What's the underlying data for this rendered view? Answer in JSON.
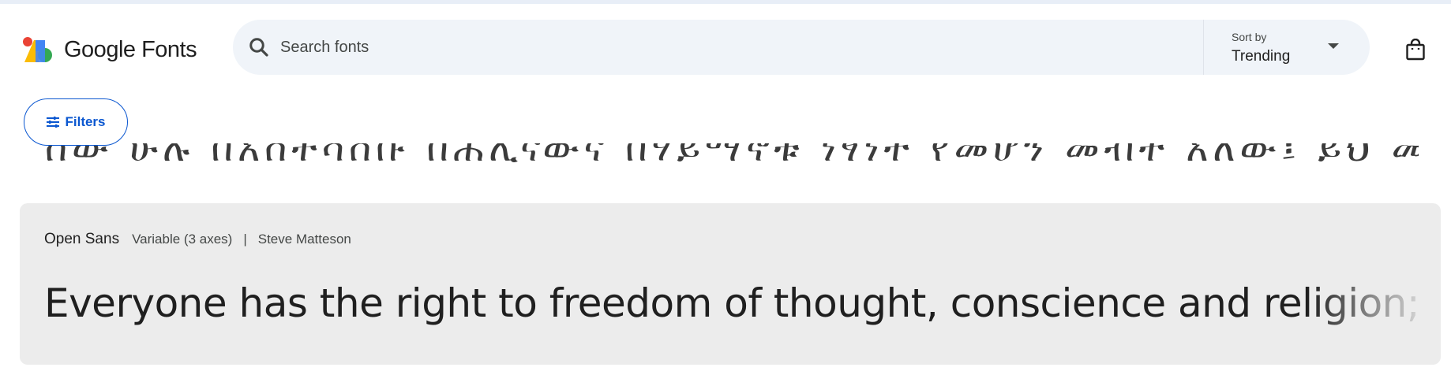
{
  "header": {
    "logo_text": "Google Fonts",
    "search": {
      "placeholder": "Search fonts",
      "value": ""
    },
    "sort": {
      "label": "Sort by",
      "value": "Trending"
    }
  },
  "filters": {
    "label": "Filters"
  },
  "clipped_preview": {
    "text": "ሰው ሁሉ በአስተሳሰቡ በሕሊናውና በሃይማኖቱ ነፃነት የመሆን መብት አለው፤ ይህ መብት ሃይማኖቱንና እምነቱን"
  },
  "font_card": {
    "name": "Open Sans",
    "variant": "Variable (3 axes)",
    "separator": "|",
    "author": "Steve Matteson",
    "preview_text": "Everyone has the right to freedom of thought, conscience and religion; this"
  },
  "colors": {
    "accent": "#0b57d0",
    "search_bg": "#f0f4f9",
    "card_bg": "#ececec",
    "logo": [
      "#ea4335",
      "#fbbc04",
      "#34a853",
      "#4285f4"
    ]
  }
}
